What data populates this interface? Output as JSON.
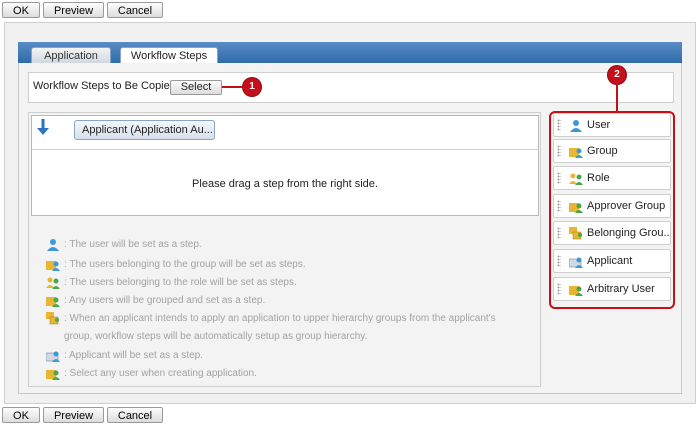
{
  "top_buttons": {
    "ok": "OK",
    "preview": "Preview",
    "cancel": "Cancel"
  },
  "bottom_buttons": {
    "ok": "OK",
    "preview": "Preview",
    "cancel": "Cancel"
  },
  "tabs": [
    {
      "label": "Application",
      "active": false
    },
    {
      "label": "Workflow Steps",
      "active": true
    }
  ],
  "copy_section": {
    "label": "Workflow Steps to Be Copied :",
    "select_label": "Select"
  },
  "callouts": {
    "one": "1",
    "two": "2"
  },
  "steps": {
    "first_step_label": "Applicant (Application Au...",
    "drag_hint": "Please drag a step from the right side."
  },
  "legend": [
    {
      "icon": "user-icon",
      "text": ": The user will be set as a step."
    },
    {
      "icon": "group-icon",
      "text": ": The users belonging to the group will be set as steps."
    },
    {
      "icon": "role-icon",
      "text": ": The users belonging to the role will be set as steps."
    },
    {
      "icon": "approver-group-icon",
      "text": ": Any users will be grouped and set as a step."
    },
    {
      "icon": "belonging-group-icon",
      "text": ": When an applicant intends to apply an application to upper hierarchy groups from the applicant's"
    },
    {
      "icon": "",
      "text": "group, workflow steps will be automatically setup as group hierarchy."
    },
    {
      "icon": "applicant-icon",
      "text": ": Applicant will be set as a step."
    },
    {
      "icon": "arbitrary-user-icon",
      "text": ": Select any user when creating application."
    }
  ],
  "palette": [
    {
      "label": "User",
      "icon": "user-icon"
    },
    {
      "label": "Group",
      "icon": "group-icon"
    },
    {
      "label": "Role",
      "icon": "role-icon"
    },
    {
      "label": "Approver Group",
      "icon": "approver-group-icon"
    },
    {
      "label": "Belonging Grou...",
      "icon": "belonging-group-icon"
    },
    {
      "label": "Applicant",
      "icon": "applicant-icon"
    },
    {
      "label": "Arbitrary User",
      "icon": "arbitrary-user-icon"
    }
  ],
  "colors": {
    "accent_red": "#c5101b",
    "tab_blue": "#2f6bab"
  }
}
